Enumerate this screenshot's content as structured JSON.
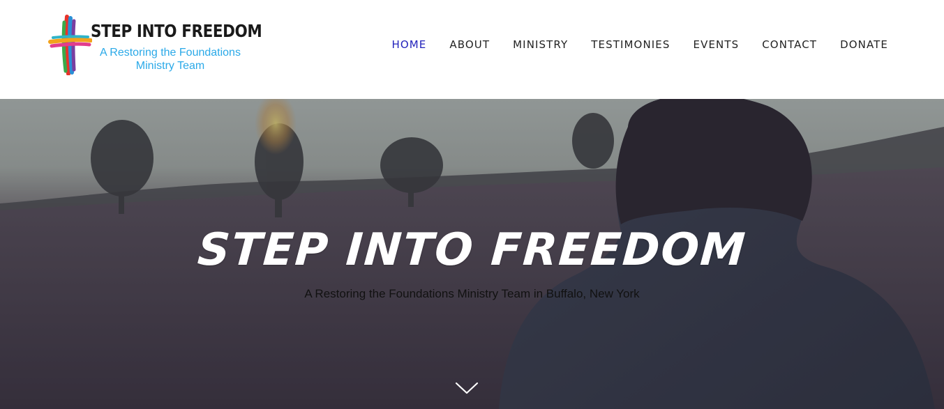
{
  "logo": {
    "title": "STEP INTO FREEDOM",
    "subtitle_line1": "A Restoring the Foundations",
    "subtitle_line2": "Ministry Team"
  },
  "nav": {
    "items": [
      {
        "label": "HOME",
        "active": true
      },
      {
        "label": "ABOUT",
        "active": false
      },
      {
        "label": "MINISTRY",
        "active": false
      },
      {
        "label": "TESTIMONIES",
        "active": false
      },
      {
        "label": "EVENTS",
        "active": false
      },
      {
        "label": "CONTACT",
        "active": false
      },
      {
        "label": "DONATE",
        "active": false
      }
    ]
  },
  "hero": {
    "title": "STEP INTO FREEDOM",
    "subtitle": "A Restoring the Foundations Ministry Team in Buffalo, New York",
    "scroll_icon": "chevron-down-icon"
  },
  "colors": {
    "nav_active": "#2222bb",
    "nav_text": "#222222",
    "logo_subtitle": "#2aa9e8",
    "hero_title": "#ffffff"
  }
}
